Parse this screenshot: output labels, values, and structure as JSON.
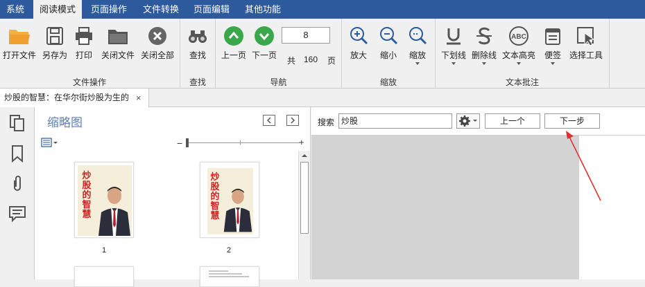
{
  "menubar": {
    "items": [
      {
        "label": "系统"
      },
      {
        "label": "阅读模式"
      },
      {
        "label": "页面操作"
      },
      {
        "label": "文件转换"
      },
      {
        "label": "页面编辑"
      },
      {
        "label": "其他功能"
      }
    ],
    "active_index": 1
  },
  "ribbon": {
    "groups": {
      "file": "文件操作",
      "find": "查找",
      "nav": "导航",
      "zoom": "缩放",
      "annot": "文本批注"
    },
    "buttons": {
      "open": "打开文件",
      "save_as": "另存为",
      "print": "打印",
      "close_file": "关闭文件",
      "close_all": "关闭全部",
      "find": "查找",
      "prev_page": "上一页",
      "next_page": "下一页",
      "zoom_in": "放大",
      "zoom_out": "缩小",
      "zoom": "缩放",
      "underline": "下划线",
      "strikeout": "删除线",
      "highlight": "文本高亮",
      "note": "便签",
      "select_tool": "选择工具"
    },
    "nav": {
      "current_page": "8",
      "total_prefix": "共",
      "total_pages": "160",
      "total_suffix": "页"
    }
  },
  "doc_tab": {
    "title": "炒股的智慧：在华尔街炒股为生的",
    "close": "×"
  },
  "thumbnails": {
    "title": "缩略图",
    "pages": [
      {
        "number": "1",
        "cover_title": "炒股的智慧"
      },
      {
        "number": "2",
        "cover_title": "炒股的智慧"
      }
    ]
  },
  "search": {
    "label": "搜索",
    "value": "炒股",
    "prev": "上一个",
    "next": "下一步"
  },
  "colors": {
    "menubar_bg": "#2d5a9c",
    "nav_green": "#3aa84a",
    "open_orange": "#f0a030",
    "annotation_arrow": "#e03030"
  }
}
